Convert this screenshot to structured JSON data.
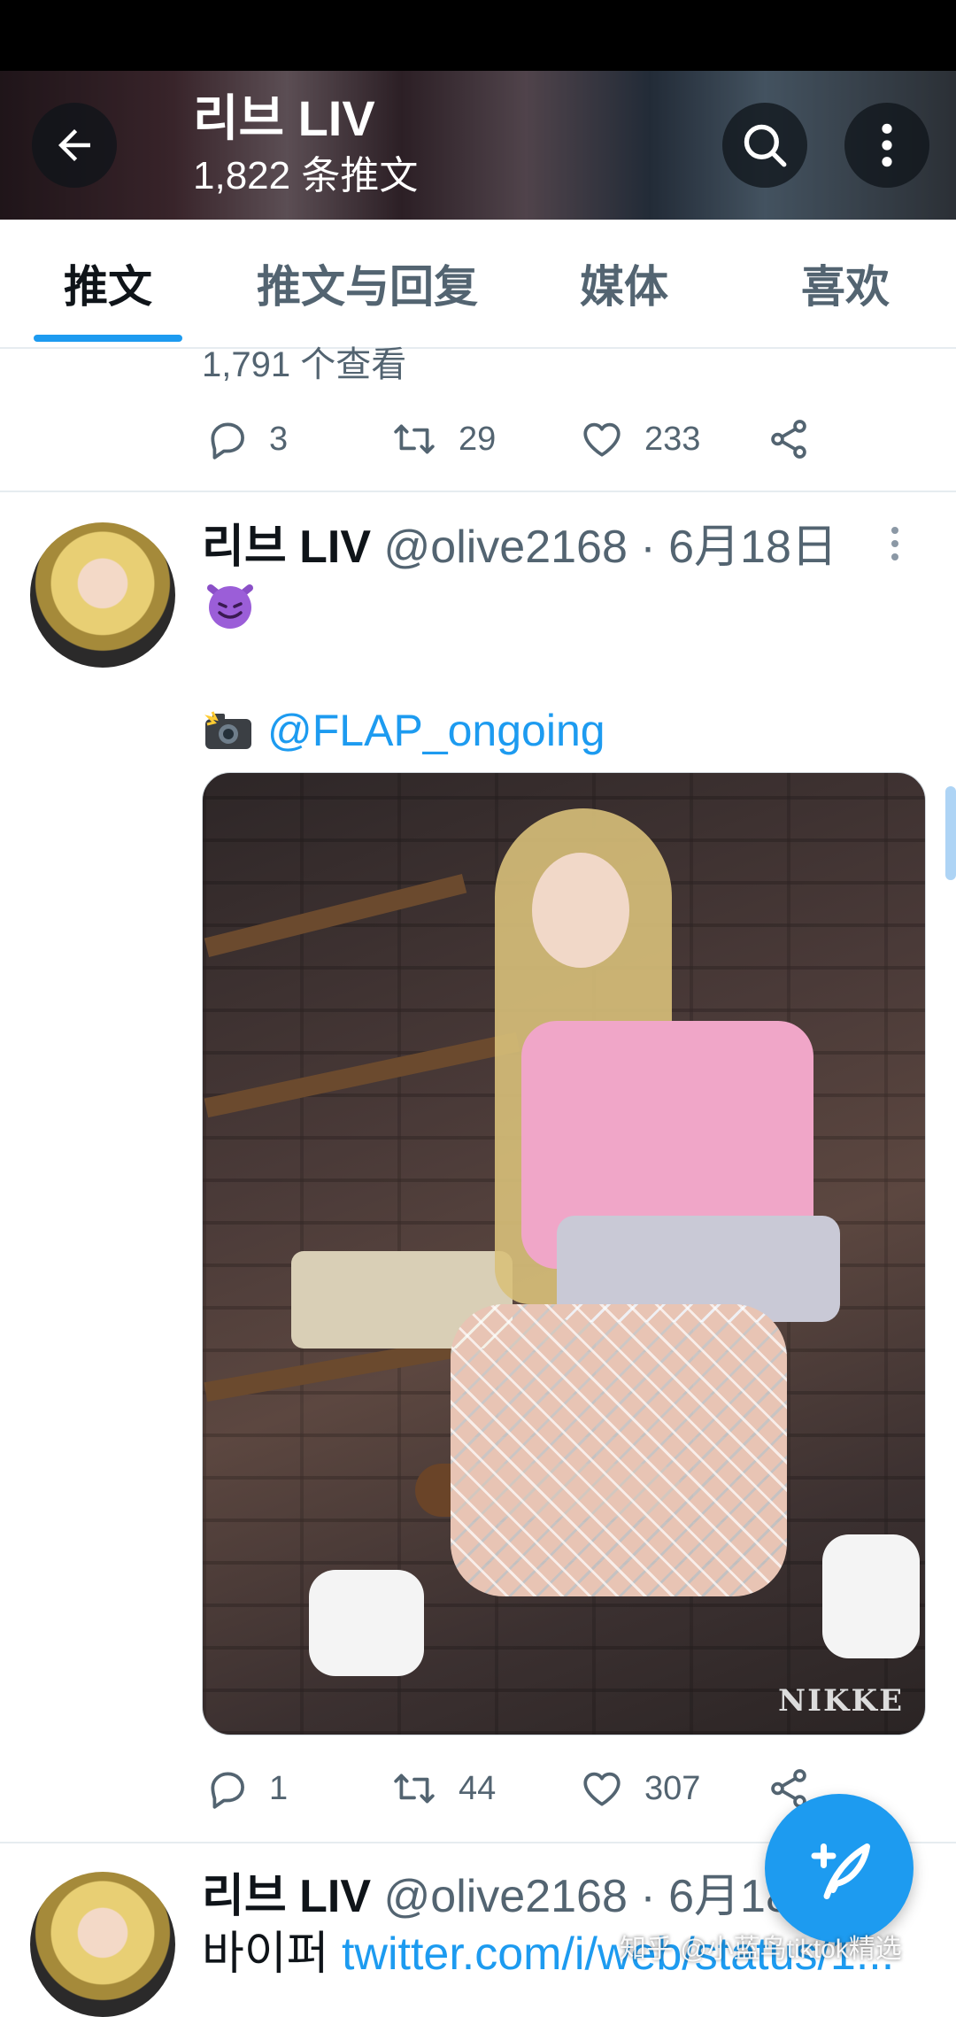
{
  "header": {
    "title": "리브 LIV",
    "subtitle": "1,822 条推文",
    "back_icon": "arrow-left-icon",
    "search_icon": "search-icon",
    "more_icon": "more-vertical-icon"
  },
  "tabs": [
    {
      "label": "推文",
      "active": true
    },
    {
      "label": "推文与回复",
      "active": false
    },
    {
      "label": "媒体",
      "active": false
    },
    {
      "label": "喜欢",
      "active": false
    }
  ],
  "accent_color": "#1d9bf0",
  "previous_tweet": {
    "views": "1,791 个查看",
    "replies": "3",
    "retweets": "29",
    "likes": "233"
  },
  "tweet": {
    "name": "리브 LIV",
    "handle_date": "@olive2168 · 6月18日",
    "emoji": "smiling-face-with-horns",
    "camera_emoji": "camera-flash",
    "mention": "@FLAP_ongoing",
    "image_watermark": "NIKKE",
    "replies": "1",
    "retweets": "44",
    "likes": "307"
  },
  "next_tweet": {
    "name": "리브 LIV",
    "handle_date": "@olive2168 · 6月18日",
    "text_prefix": "바이퍼 ",
    "link": "twitter.com/i/web/status/1..."
  },
  "compose_button_icon": "feather-plus-icon",
  "watermark": "知乎 @小蓝鸟tiktok精选"
}
